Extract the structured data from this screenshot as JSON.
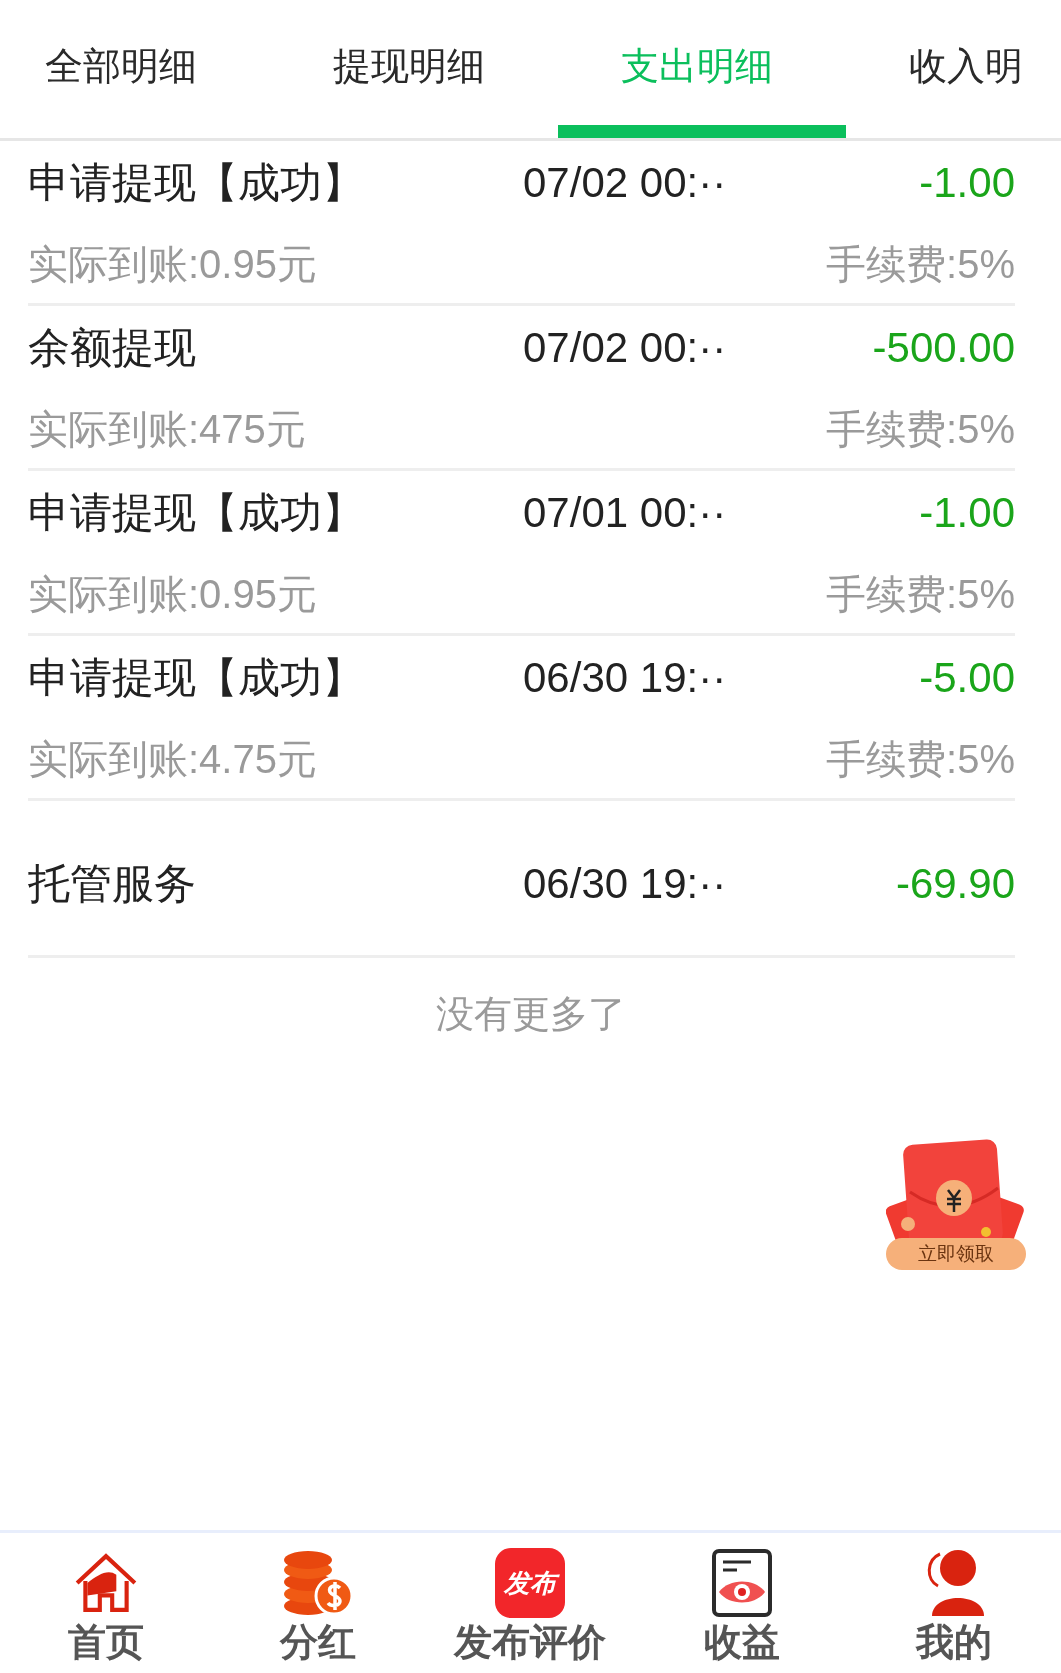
{
  "tabs": [
    {
      "label": "全部明细",
      "selected": false
    },
    {
      "label": "提现明细",
      "selected": false
    },
    {
      "label": "支出明细",
      "selected": true
    },
    {
      "label": "收入明",
      "selected": false
    }
  ],
  "records": [
    {
      "title": "申请提现【成功】",
      "time": "07/02 00:··",
      "amount": "-1.00",
      "received": "实际到账:0.95元",
      "fee": "手续费:5%"
    },
    {
      "title": "余额提现",
      "time": "07/02 00:··",
      "amount": "-500.00",
      "received": "实际到账:475元",
      "fee": "手续费:5%"
    },
    {
      "title": "申请提现【成功】",
      "time": "07/01 00:··",
      "amount": "-1.00",
      "received": "实际到账:0.95元",
      "fee": "手续费:5%"
    },
    {
      "title": "申请提现【成功】",
      "time": "06/30 19:··",
      "amount": "-5.00",
      "received": "实际到账:4.75元",
      "fee": "手续费:5%"
    },
    {
      "title": "托管服务",
      "time": "06/30 19:··",
      "amount": "-69.90"
    }
  ],
  "end_note": "没有更多了",
  "floating_reward": {
    "label": "立即领取"
  },
  "bottom_nav": [
    {
      "kind": "home",
      "label": "首页"
    },
    {
      "kind": "coins",
      "label": "分红"
    },
    {
      "kind": "publish",
      "label": "发布评价",
      "badge": "发布"
    },
    {
      "kind": "earnings",
      "label": "收益"
    },
    {
      "kind": "profile",
      "label": "我的"
    }
  ]
}
